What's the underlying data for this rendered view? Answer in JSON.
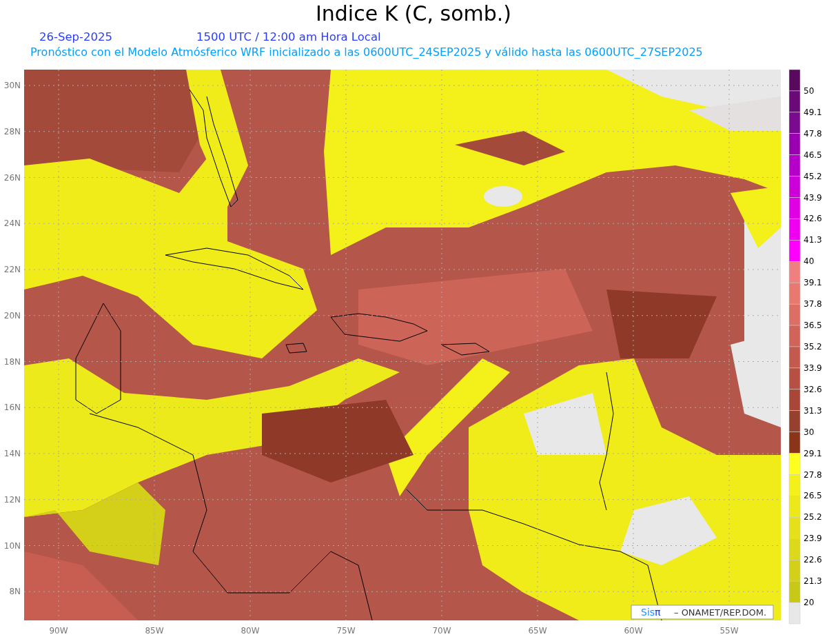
{
  "title": "Indice K (C, somb.)",
  "date": "26-Sep-2025",
  "time": "1500 UTC / 12:00 am Hora Local",
  "subtitle": "Pronóstico con el Modelo Atmósferico WRF inicializado a las 0600UTC_24SEP2025 y válido hasta las  0600UTC_27SEP2025",
  "lat_labels": [
    "30N",
    "28N",
    "26N",
    "24N",
    "22N",
    "20N",
    "18N",
    "16N",
    "14N",
    "12N",
    "10N",
    "8N"
  ],
  "lon_labels": [
    "90W",
    "85W",
    "80W",
    "75W",
    "70W",
    "65W",
    "60W",
    "55W"
  ],
  "colorbar": {
    "segments": [
      {
        "color": "#5a0a5e"
      },
      {
        "color": "#6a0a78"
      },
      {
        "color": "#7a0a90"
      },
      {
        "color": "#9a00b0"
      },
      {
        "color": "#b400c8"
      },
      {
        "color": "#cc00d8"
      },
      {
        "color": "#e000e4"
      },
      {
        "color": "#f000f0"
      },
      {
        "color": "#ff00ff"
      },
      {
        "color": "#f08080"
      },
      {
        "color": "#e87870"
      },
      {
        "color": "#dc6e64"
      },
      {
        "color": "#d0645a"
      },
      {
        "color": "#c45a4e"
      },
      {
        "color": "#b65044"
      },
      {
        "color": "#a8463a"
      },
      {
        "color": "#984030"
      },
      {
        "color": "#8a3418"
      },
      {
        "color": "#ffff20"
      },
      {
        "color": "#f4f01a"
      },
      {
        "color": "#ece81a"
      },
      {
        "color": "#e4e01a"
      },
      {
        "color": "#dcd81a"
      },
      {
        "color": "#d4d01a"
      },
      {
        "color": "#c8c818"
      },
      {
        "color": "#e8e8e8"
      }
    ],
    "labels": [
      "50",
      "49.1",
      "47.8",
      "46.5",
      "45.2",
      "43.9",
      "42.6",
      "41.3",
      "40",
      "39.1",
      "37.8",
      "36.5",
      "35.2",
      "33.9",
      "32.6",
      "31.3",
      "30",
      "29.1",
      "27.8",
      "26.5",
      "25.2",
      "23.9",
      "22.6",
      "21.3",
      "20"
    ]
  },
  "credit": {
    "logo": "Sis",
    "symbol": "π",
    "text": "– ONAMET/REP.DOM."
  }
}
